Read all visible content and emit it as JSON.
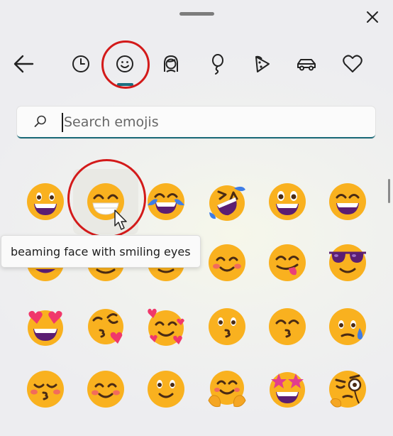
{
  "window": {
    "close_icon": "close-icon",
    "drag_handle": "drag-handle"
  },
  "nav": {
    "back_icon": "back-arrow-icon",
    "categories": [
      {
        "name": "recent",
        "icon": "clock-icon"
      },
      {
        "name": "smiley-faces",
        "icon": "smiley-icon",
        "selected": true
      },
      {
        "name": "people",
        "icon": "person-icon"
      },
      {
        "name": "celebrations",
        "icon": "balloon-icon"
      },
      {
        "name": "food",
        "icon": "pizza-icon"
      },
      {
        "name": "transport",
        "icon": "car-icon"
      },
      {
        "name": "symbols",
        "icon": "heart-icon"
      }
    ]
  },
  "search": {
    "placeholder": "Search emojis",
    "value": ""
  },
  "tooltip": {
    "text": "beaming face with smiling eyes"
  },
  "emoji_grid": [
    [
      "grinning-face",
      "beaming-face-with-smiling-eyes",
      "face-with-tears-of-joy",
      "rolling-on-the-floor-laughing",
      "grinning-face-with-big-eyes",
      "grinning-face-with-smiling-eyes"
    ],
    [
      "partially-hidden",
      "partially-hidden",
      "partially-hidden",
      "smiling-face-with-smiling-eyes",
      "face-savoring-food",
      "smiling-face-with-sunglasses"
    ],
    [
      "smiling-face-with-heart-eyes",
      "face-blowing-a-kiss",
      "smiling-face-with-hearts",
      "kissing-face",
      "kissing-face-with-smiling-eyes",
      "face-with-tear"
    ],
    [
      "kissing-face-with-closed-eyes",
      "smiling-face-with-smiling-eyes",
      "slightly-smiling-face",
      "hugging-face",
      "star-struck",
      "face-with-monocle"
    ]
  ],
  "colors": {
    "accent": "#1a6f80",
    "highlight_ring": "#d31a1a",
    "emoji_face": "#f9b11f"
  }
}
